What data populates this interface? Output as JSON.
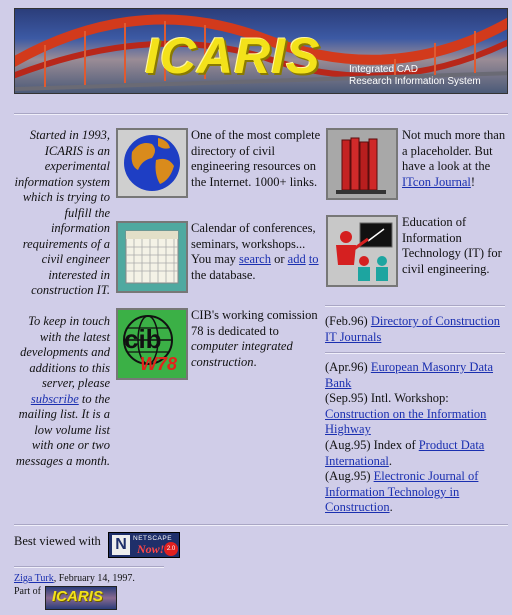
{
  "banner": {
    "logo": "ICARIS",
    "subtitle_line1": "Integrated CAD",
    "subtitle_line2": "Research Information System"
  },
  "intro_text": "Started in 1993, ICARIS is an experimental information system which is trying to fulfill the information requirements of a civil engineer interested in construction IT.",
  "keep_in_touch": {
    "before": "To keep in touch with the latest developments and additions to this server, please ",
    "link": "subscribe",
    "after": " to the mailing list. It is a low volume list with one or two messages a month."
  },
  "items": {
    "directory": {
      "text": "One of the most complete directory of civil engineering resources on the Internet. 1000+ links."
    },
    "calendar": {
      "before": "Calendar of conferences, seminars, workshops... You may ",
      "search": "search",
      "middle": " or ",
      "add": "add",
      "to": "to",
      "after": " the database."
    },
    "cib": {
      "before": "CIB's working comission 78 is dedicated to ",
      "em": "computer integrated construction",
      "after": "."
    },
    "placeholder": {
      "before": "Not much more than a placeholder. But have a look at the ",
      "link": "ITcon Journal",
      "after": "!"
    },
    "education": {
      "text": "Education of Information Technology (IT) for civil engineering."
    }
  },
  "icons": {
    "cib_label_top": "cib",
    "cib_label_bottom": "W78"
  },
  "news": [
    {
      "date": "(Feb.96) ",
      "link": "Directory of Construction IT Journals",
      "after": ""
    },
    {
      "date": "(Apr.96) ",
      "link": "European Masonry Data Bank",
      "after": ""
    },
    {
      "date": "(Sep.95) Intl. Workshop: ",
      "link": "Construction on the Information Highway",
      "after": ""
    },
    {
      "date": "(Aug.95) Index of ",
      "link": "Product Data International",
      "after": "."
    },
    {
      "date": "(Aug.95) ",
      "link": "Electronic Journal of Information Technology in Construction",
      "after": "."
    }
  ],
  "footer": {
    "best_viewed": "Best viewed with",
    "netscape_top": "NETSCAPE",
    "netscape_now": "Now!",
    "netscape_letter": "N",
    "netscape_badge": "2.0",
    "author_link": "Ziga Turk",
    "author_date": ", February 14, 1997.",
    "part_of": "Part of",
    "mini_logo": "ICARIS"
  },
  "colors": {
    "background": "#d0cde8",
    "link": "#1a2fb0",
    "logo_yellow": "#f3e21a"
  }
}
